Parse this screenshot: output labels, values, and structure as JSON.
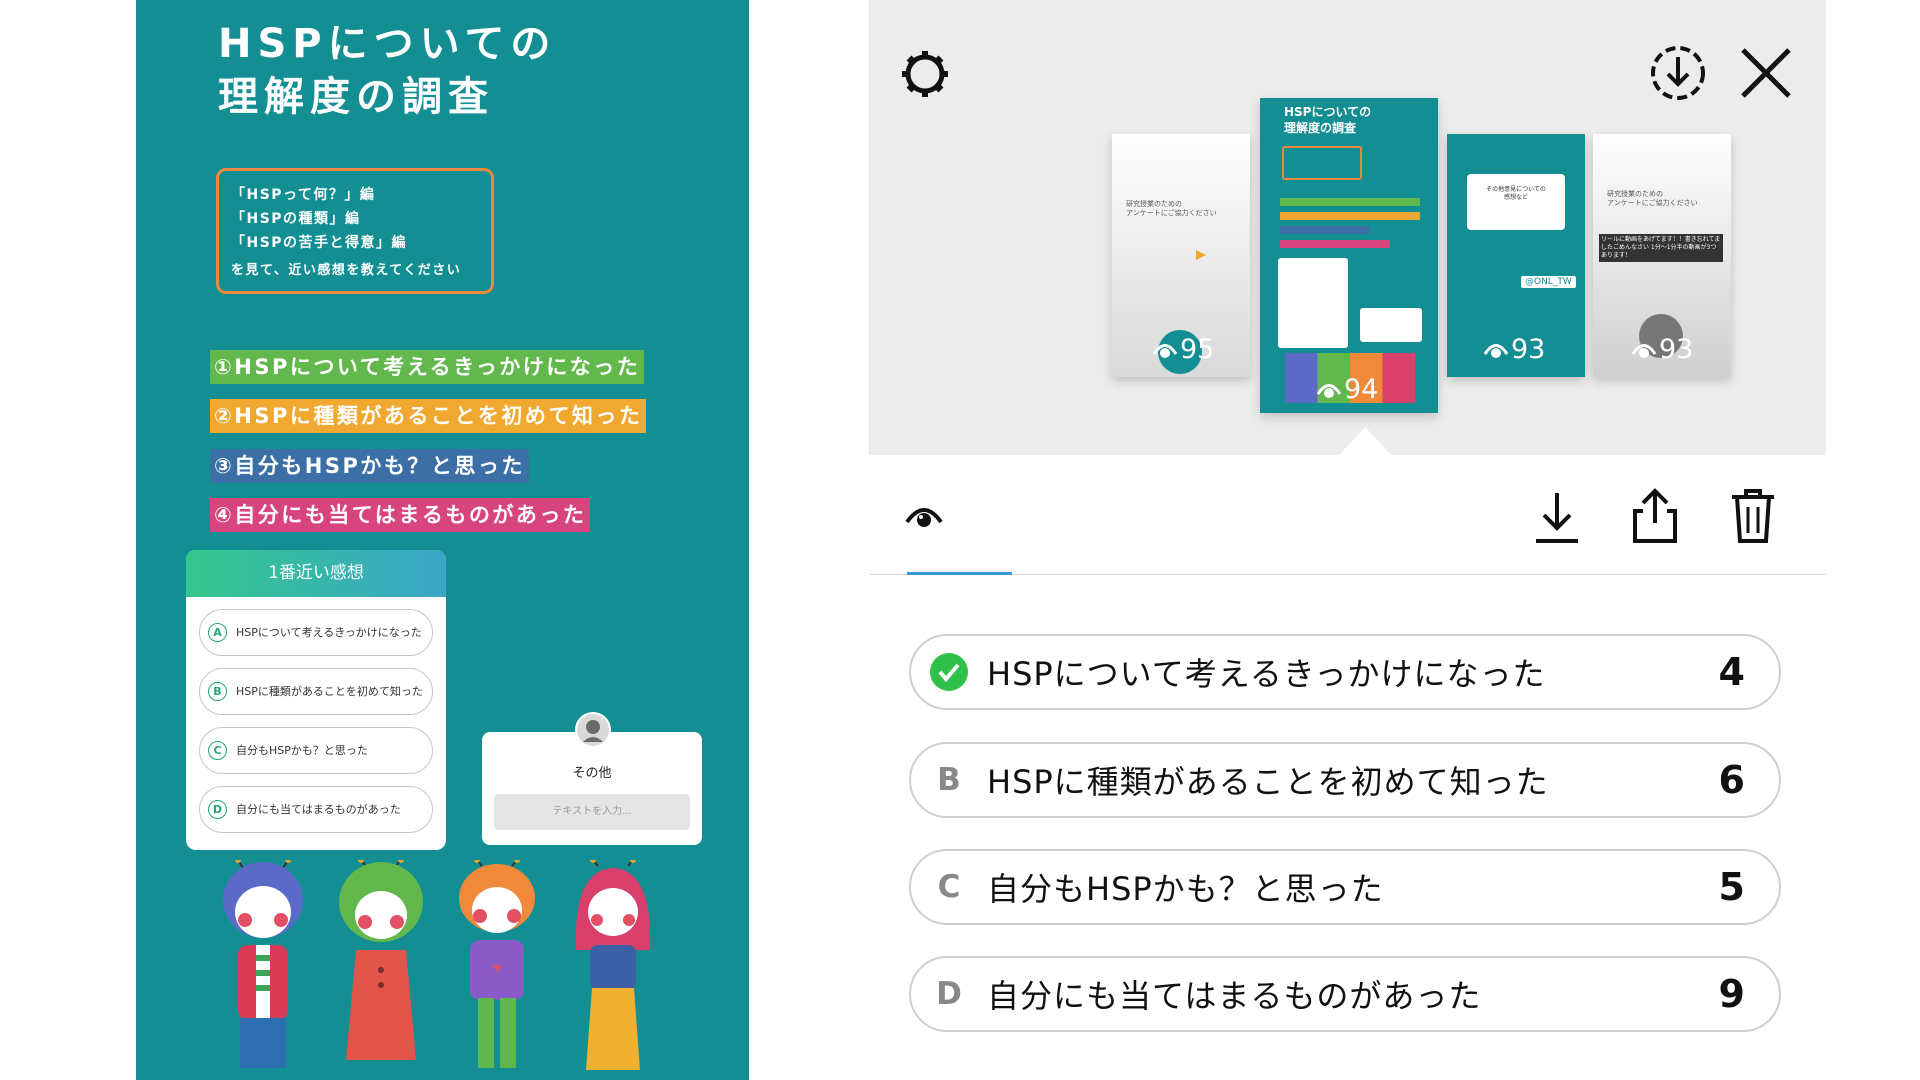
{
  "story": {
    "title_line1": "HSPについての",
    "title_line2": "理解度の調査",
    "instructions": [
      "「HSPって何？」編",
      "「HSPの種類」編",
      "「HSPの苦手と得意」編",
      "を見て、近い感想を教えてください"
    ],
    "highlights": [
      "①HSPについて考えるきっかけになった",
      "②HSPに種類があることを初めて知った",
      "③自分もHSPかも？と思った",
      "④自分にも当てはまるものがあった"
    ],
    "poll": {
      "title": "1番近い感想",
      "options": [
        {
          "letter": "A",
          "text": "HSPについて考えるきっかけになった"
        },
        {
          "letter": "B",
          "text": "HSPに種類があることを初めて知った"
        },
        {
          "letter": "C",
          "text": "自分もHSPかも？と思った"
        },
        {
          "letter": "D",
          "text": "自分にも当てはまるものがあった"
        }
      ]
    },
    "question_box": {
      "label": "その他",
      "placeholder": "テキストを入力..."
    }
  },
  "panel": {
    "thumbnails": [
      {
        "views": "95",
        "text_line1": "研究授業のための",
        "text_line2": "アンケートにご協力ください"
      },
      {
        "views": "94",
        "text_line1": "HSPについての",
        "text_line2": "理解度の調査"
      },
      {
        "views": "93",
        "text_line1": "その他意見についての",
        "text_line2": "感想など",
        "sticker": "@ONL_TW"
      },
      {
        "views": "93",
        "text_line1": "研究授業のための",
        "text_line2": "アンケートにご協力ください",
        "caption": "リールに動画をあげてます！！書き忘れてましたごめんなさい 1分〜1分半の動画が3つあります！"
      }
    ],
    "results": [
      {
        "letter": "✓",
        "text": "HSPについて考えるきっかけになった",
        "count": "4",
        "correct": true
      },
      {
        "letter": "B",
        "text": "HSPに種類があることを初めて知った",
        "count": "6",
        "correct": false
      },
      {
        "letter": "C",
        "text": "自分もHSPかも？と思った",
        "count": "5",
        "correct": false
      },
      {
        "letter": "D",
        "text": "自分にも当てはまるものがあった",
        "count": "9",
        "correct": false
      }
    ]
  },
  "colors": {
    "story_bg": "#138f94",
    "correct": "#2ec04a",
    "tab_accent": "#3a97d4"
  }
}
